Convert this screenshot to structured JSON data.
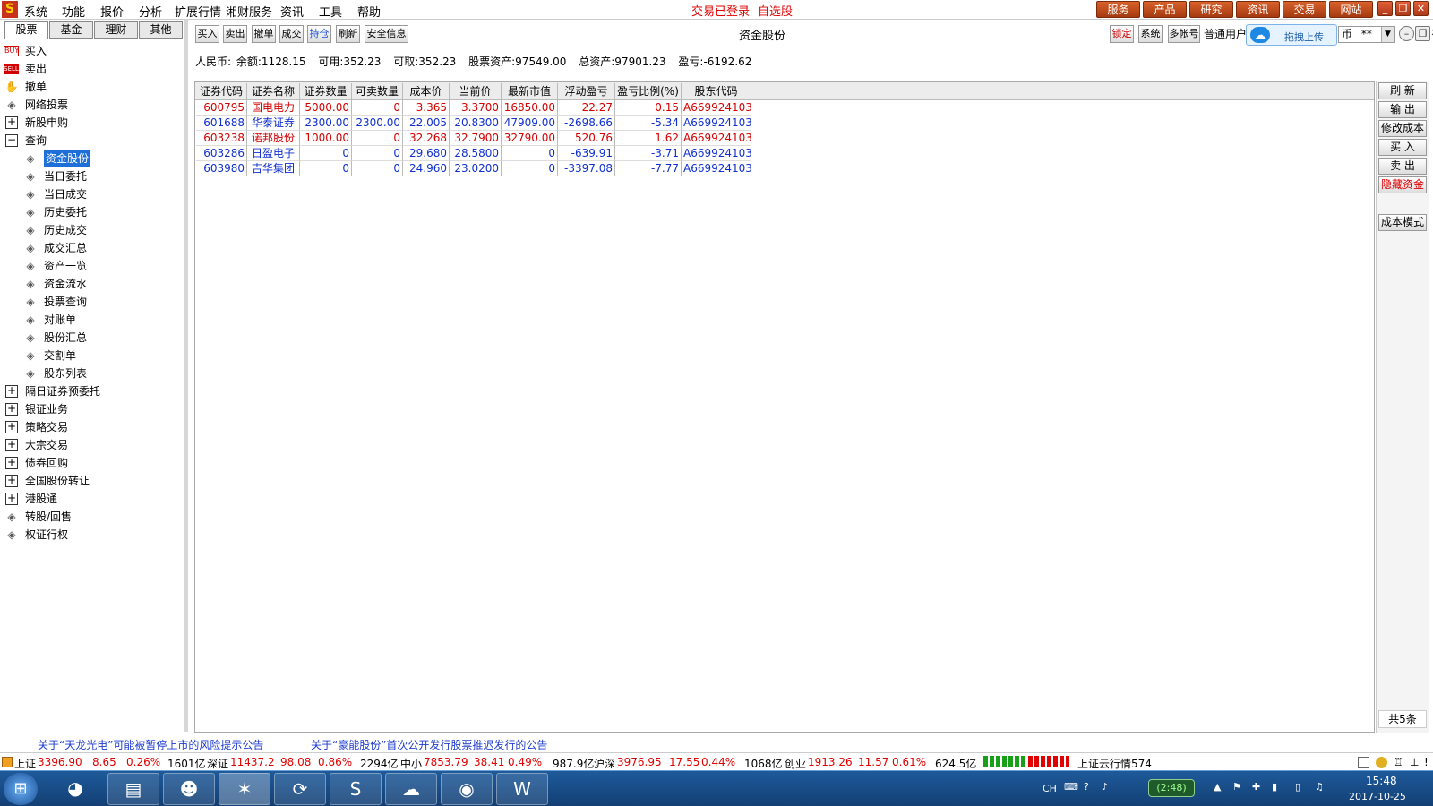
{
  "menubar": {
    "app_glyph": "S",
    "menus": [
      "系统",
      "功能",
      "报价",
      "分析",
      "扩展行情",
      "湘财服务",
      "资讯",
      "工具",
      "帮助"
    ],
    "status_login": "交易已登录",
    "status_watch": "自选股",
    "right_buttons": [
      "服务",
      "产品",
      "研究",
      "资讯",
      "交易",
      "网站"
    ]
  },
  "left": {
    "tabs": [
      "股票",
      "基金",
      "理财",
      "其他"
    ],
    "tree_top": [
      {
        "label": "买入",
        "icon": "BUY"
      },
      {
        "label": "卖出",
        "icon": "SELL"
      },
      {
        "label": "撤单",
        "icon": "hand-icon"
      },
      {
        "label": "网络投票",
        "icon": "diamond"
      },
      {
        "label": "新股申购",
        "icon": "plus"
      },
      {
        "label": "查询",
        "icon": "minus"
      }
    ],
    "query_children": [
      "资金股份",
      "当日委托",
      "当日成交",
      "历史委托",
      "历史成交",
      "成交汇总",
      "资产一览",
      "资金流水",
      "投票查询",
      "对账单",
      "股份汇总",
      "交割单",
      "股东列表"
    ],
    "tree_bottom": [
      {
        "label": "隔日证券预委托",
        "icon": "plus"
      },
      {
        "label": "银证业务",
        "icon": "plus"
      },
      {
        "label": "策略交易",
        "icon": "plus"
      },
      {
        "label": "大宗交易",
        "icon": "plus"
      },
      {
        "label": "债券回购",
        "icon": "plus"
      },
      {
        "label": "全国股份转让",
        "icon": "plus"
      },
      {
        "label": "港股通",
        "icon": "plus"
      },
      {
        "label": "转股/回售",
        "icon": "diamond"
      },
      {
        "label": "权证行权",
        "icon": "diamond"
      }
    ]
  },
  "toolbar": {
    "buttons": [
      "买入",
      "卖出",
      "撤单",
      "成交",
      "持仓",
      "刷新",
      "安全信息"
    ],
    "right_buttons": [
      "锁定",
      "系统",
      "多帐号"
    ],
    "account_type": "普通用户",
    "currency_fragment": "币",
    "masked": "**"
  },
  "page_title": "资金股份",
  "popup": {
    "label": "拖拽上传"
  },
  "summary": {
    "currency": "人民币:",
    "balance": "余额:1128.15",
    "available": "可用:352.23",
    "withdrawable": "可取:352.23",
    "stock_assets": "股票资产:97549.00",
    "total_assets": "总资产:97901.23",
    "profit_loss": "盈亏:-6192.62"
  },
  "table": {
    "headers": [
      "证券代码",
      "证券名称",
      "证券数量",
      "可卖数量",
      "成本价",
      "当前价",
      "最新市值",
      "浮动盈亏",
      "盈亏比例(%)",
      "股东代码"
    ],
    "rows": [
      {
        "code": "600795",
        "name": "国电电力",
        "qty": "5000.00",
        "sellable": "0",
        "cost": "3.365",
        "price": "3.3700",
        "value": "16850.00",
        "pl": "22.27",
        "pct": "0.15",
        "holder": "A669924103",
        "color": "#d40000"
      },
      {
        "code": "601688",
        "name": "华泰证券",
        "qty": "2300.00",
        "sellable": "2300.00",
        "cost": "22.005",
        "price": "20.8300",
        "value": "47909.00",
        "pl": "-2698.66",
        "pct": "-5.34",
        "holder": "A669924103",
        "color": "#1030d0"
      },
      {
        "code": "603238",
        "name": "诺邦股份",
        "qty": "1000.00",
        "sellable": "0",
        "cost": "32.268",
        "price": "32.7900",
        "value": "32790.00",
        "pl": "520.76",
        "pct": "1.62",
        "holder": "A669924103",
        "color": "#d40000"
      },
      {
        "code": "603286",
        "name": "日盈电子",
        "qty": "0",
        "sellable": "0",
        "cost": "29.680",
        "price": "28.5800",
        "value": "0",
        "pl": "-639.91",
        "pct": "-3.71",
        "holder": "A669924103",
        "color": "#1030d0"
      },
      {
        "code": "603980",
        "name": "吉华集团",
        "qty": "0",
        "sellable": "0",
        "cost": "24.960",
        "price": "23.0200",
        "value": "0",
        "pl": "-3397.08",
        "pct": "-7.77",
        "holder": "A669924103",
        "color": "#1030d0"
      }
    ]
  },
  "right_panel": {
    "buttons": [
      "刷 新",
      "输 出",
      "修改成本",
      "买 入",
      "卖 出",
      "隐藏资金"
    ],
    "mode_button": "成本模式",
    "count": "共5条"
  },
  "news": [
    "关于“天龙光电”可能被暂停上市的风险提示公告",
    "关于“豪能股份”首次公开发行股票推迟发行的公告"
  ],
  "ticker": {
    "sh_label": "上证",
    "sh_val": "3396.90",
    "sh_chg": "8.65",
    "sh_pct": "0.26%",
    "sh_vol": "1601亿",
    "sz_label": "深证",
    "sz_val": "11437.2",
    "sz_chg": "98.08",
    "sz_pct": "0.86%",
    "sz_vol": "2294亿",
    "zx_label": "中小",
    "zx_val": "7853.79",
    "zx_chg": "38.41",
    "zx_pct": "0.49%",
    "zx_vol": "987.9亿",
    "hs_label": "沪深",
    "hs_val": "3976.95",
    "hs_chg": "17.55",
    "hs_pct": "0.44%",
    "hs_vol": "1068亿",
    "cy_label": "创业",
    "cy_val": "1913.26",
    "cy_chg": "11.57",
    "cy_pct": "0.61%",
    "cy_vol": "624.5亿",
    "cloud": "上证云行情574"
  },
  "taskbar": {
    "lang": "CH",
    "battery": "(2:48)",
    "time": "15:48",
    "date": "2017-10-25",
    "apps": [
      "windows-start-icon",
      "browser-icon",
      "folder-icon",
      "sogou-icon",
      "trading-app-icon",
      "360-icon",
      "s-browser-icon",
      "cloud-icon",
      "shield-icon",
      "w-icon"
    ]
  },
  "colors": {
    "accent_red": "#e00000",
    "accent_blue": "#1030d0",
    "orange": "#c14e1c",
    "selection": "#1e6fd8"
  }
}
